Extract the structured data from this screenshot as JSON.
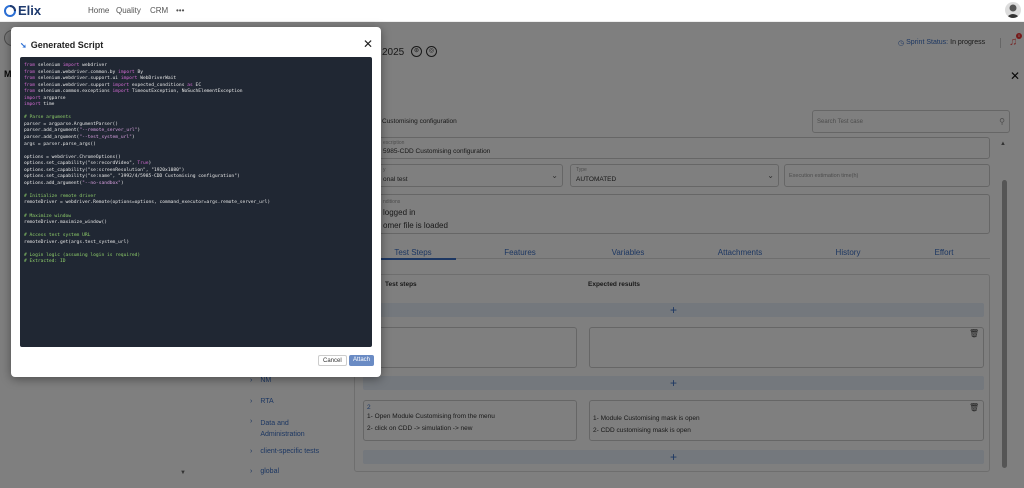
{
  "topnav": {
    "logo": "Elix",
    "items": [
      "Home",
      "Quality",
      "CRM",
      "•••"
    ]
  },
  "header": {
    "year_fragment": "2025",
    "sprint_status_label": "Sprint Status:",
    "sprint_status_value": "In progress",
    "notification_count": "0",
    "left_initial": "M"
  },
  "form": {
    "name_partial": "Customising configuration",
    "search_placeholder": "Search Test case",
    "description_label": "escription",
    "description_value": "5985-CDD Customising configuration",
    "category_label": "y",
    "category_value": "onal test",
    "type_label": "Type",
    "type_value": "AUTOMATED",
    "exec_placeholder": "Execution estimation time(h)",
    "preconditions_label": "nditions",
    "preconditions_line1": "logged in",
    "preconditions_line2": "omer file is loaded"
  },
  "tabs": [
    "Test Steps",
    "Features",
    "Variables",
    "Attachments",
    "History",
    "Effort"
  ],
  "steps_table": {
    "col1": "Test steps",
    "col2": "Expected results",
    "plus": "+",
    "step2": {
      "number": "2",
      "line1": "1- Open Module Customising from the menu",
      "line2": "2- click on CDD -> simulation -> new",
      "result1": "1- Module Customising mask is open",
      "result2": "2- CDD customising mask is open"
    }
  },
  "sidenav": [
    {
      "label": "NM"
    },
    {
      "label": "RTA"
    },
    {
      "label": "Data and Administration"
    },
    {
      "label": "client-specific tests"
    },
    {
      "label": "global"
    }
  ],
  "modal": {
    "title": "Generated Script",
    "close": "✕",
    "code_lines": [
      [
        "kw:from",
        " selenium ",
        "kw:import",
        " webdriver"
      ],
      [
        "kw:from",
        " selenium.webdriver.common.by ",
        "kw:import",
        " By"
      ],
      [
        "kw:from",
        " selenium.webdriver.support.ui ",
        "kw:import",
        " WebDriverWait"
      ],
      [
        "kw:from",
        " selenium.webdriver.support ",
        "kw:import",
        " expected_conditions ",
        "kw:as",
        " EC"
      ],
      [
        "kw:from",
        " selenium.common.exceptions ",
        "kw:import",
        " TimeoutException, NoSuchElementException"
      ],
      [
        "kw:import",
        " argparse"
      ],
      [
        "kw:import",
        " time"
      ],
      [
        ""
      ],
      [
        "cm:# Parse arguments"
      ],
      [
        "parser = argparse.ArgumentParser()"
      ],
      [
        "parser.add_argument(",
        "st:\"--remote_server_url\"",
        ")"
      ],
      [
        "parser.add_argument(",
        "st:\"--test_system_url\"",
        ")"
      ],
      [
        "args = parser.parse_args()"
      ],
      [
        ""
      ],
      [
        "options = webdriver.ChromeOptions()"
      ],
      [
        "options.set_capability(\"se:recordVideo\", ",
        "kw:True",
        ")"
      ],
      [
        "options.set_capability(\"se:screenResolution\", \"1920x1080\")"
      ],
      [
        "options.set_capability(\"se:name\", \"3992/4/5985-CDD Customising configuration\")"
      ],
      [
        "options.add_argument(",
        "st:\"--no-sandbox\"",
        ")"
      ],
      [
        ""
      ],
      [
        "cm:# Initialize remote driver"
      ],
      [
        "remoteDriver = webdriver.Remote(options=options, command_executor=args.remote_server_url)"
      ],
      [
        ""
      ],
      [
        "cm:# Maximize window"
      ],
      [
        "remoteDriver.maximize_window()"
      ],
      [
        ""
      ],
      [
        "cm:# Access test system URL"
      ],
      [
        "remoteDriver.get(args.test_system_url)"
      ],
      [
        ""
      ],
      [
        "cm:# Login logic (assuming login is required)"
      ],
      [
        "cm:# Extracted: ID"
      ]
    ],
    "cancel": "Cancel",
    "attach": "Attach"
  }
}
